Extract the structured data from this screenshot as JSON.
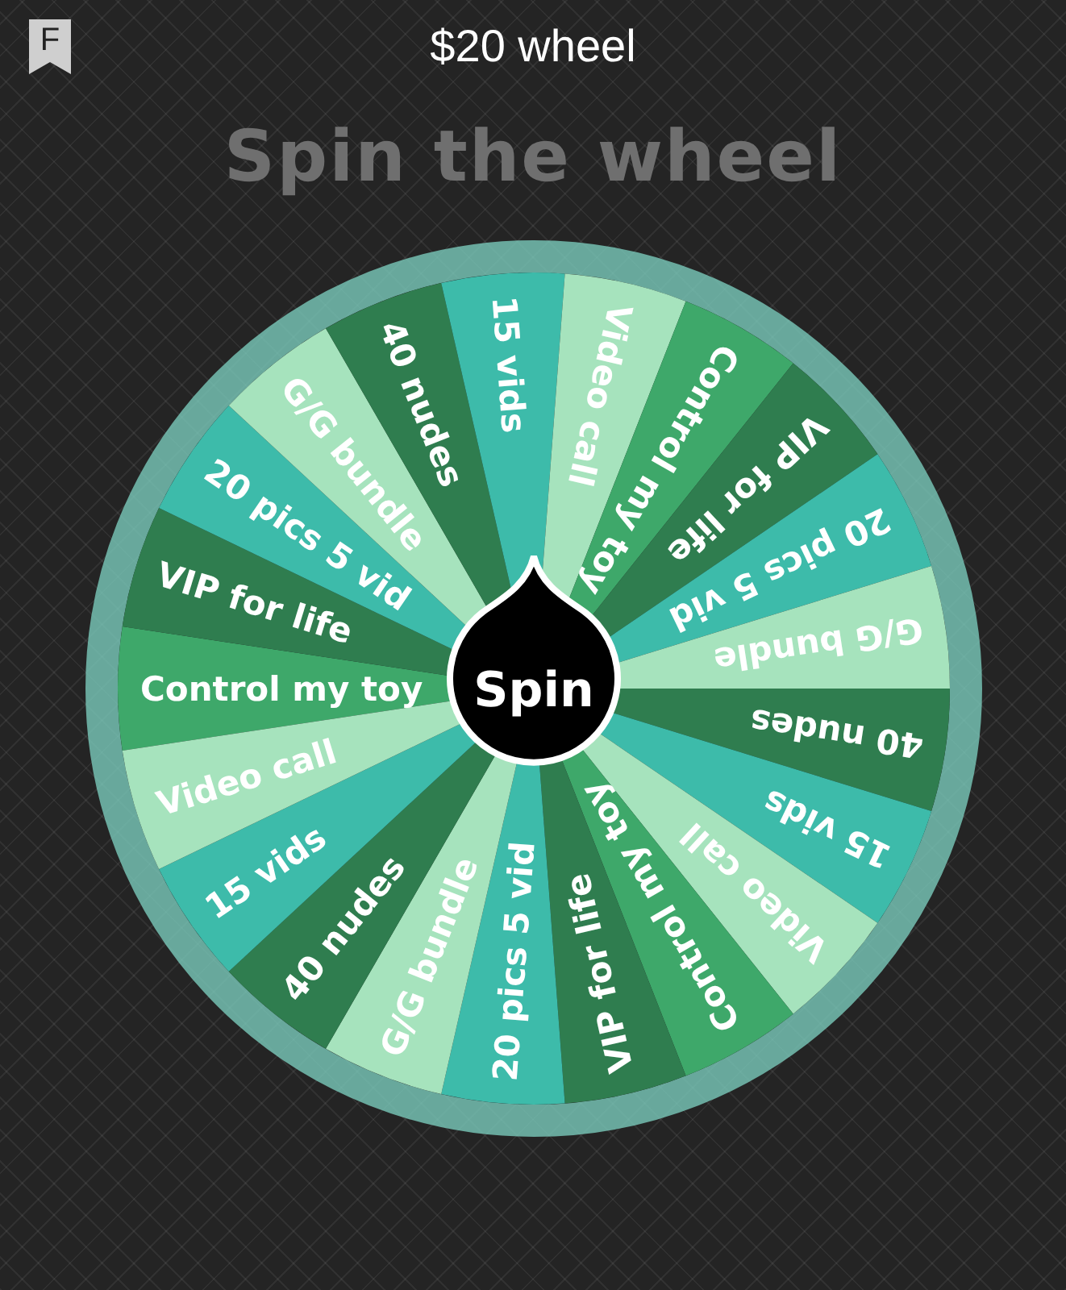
{
  "app_badge": "F",
  "title": "$20 wheel",
  "heading": "Spin the wheel",
  "segments": [
    {
      "label": "Control my toy",
      "color": "#3ea86a"
    },
    {
      "label": "VIP for life",
      "color": "#2f7d4f"
    },
    {
      "label": "20 pics 5 vid",
      "color": "#3dbbaa"
    },
    {
      "label": "G/G bundle",
      "color": "#a6e3bd"
    },
    {
      "label": "40 nudes",
      "color": "#2f7d4f"
    },
    {
      "label": "15 vids",
      "color": "#3dbbaa"
    },
    {
      "label": "Video call",
      "color": "#a6e3bd"
    },
    {
      "label": "Control my toy",
      "color": "#3ea86a"
    },
    {
      "label": "VIP for life",
      "color": "#2f7d4f"
    },
    {
      "label": "20 pics 5 vid",
      "color": "#3dbbaa"
    },
    {
      "label": "G/G bundle",
      "color": "#a6e3bd"
    },
    {
      "label": "40 nudes",
      "color": "#2f7d4f"
    },
    {
      "label": "15 vids",
      "color": "#3dbbaa"
    },
    {
      "label": "Video call",
      "color": "#a6e3bd"
    },
    {
      "label": "Control my toy",
      "color": "#3ea86a"
    },
    {
      "label": "VIP for life",
      "color": "#2f7d4f"
    },
    {
      "label": "20 pics 5 vid",
      "color": "#3dbbaa"
    },
    {
      "label": "G/G bundle",
      "color": "#a6e3bd"
    },
    {
      "label": "40 nudes",
      "color": "#2f7d4f"
    },
    {
      "label": "15 vids",
      "color": "#3dbbaa"
    },
    {
      "label": "Video call",
      "color": "#a6e3bd"
    }
  ],
  "spin_button": "Spin"
}
